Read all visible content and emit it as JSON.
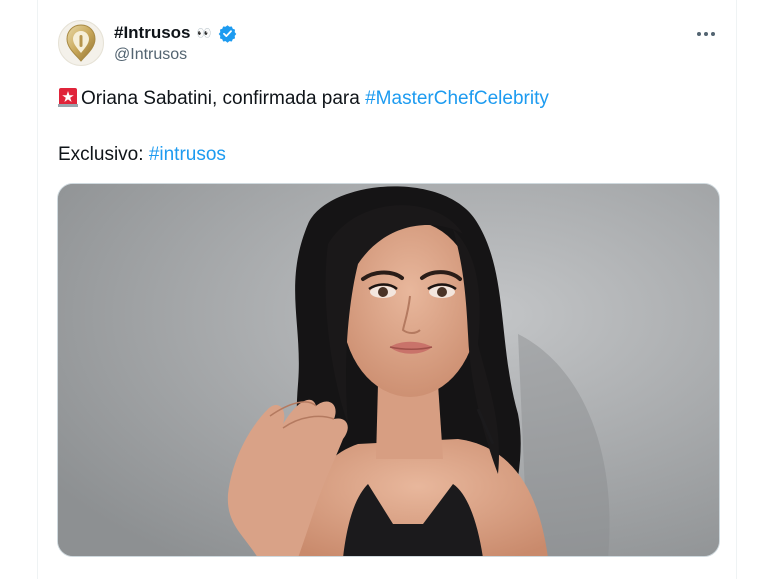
{
  "tweet": {
    "display_name": "#Intrusos",
    "name_emoji": "👀",
    "handle": "@Intrusos",
    "verified_icon": "verified-badge-icon",
    "more_icon": "more-options-icon",
    "line1": {
      "emoji_icon": "police-light-icon",
      "text": "Oriana Sabatini, confirmada para ",
      "hashtag": "#MasterChefCelebrity"
    },
    "line2": {
      "text": "Exclusivo: ",
      "hashtag": "#intrusos"
    },
    "media_alt": "photo"
  },
  "colors": {
    "link": "#1d9bf0",
    "verified": "#1d9bf0",
    "secondary_text": "#536471",
    "siren_red": "#e0243a"
  }
}
